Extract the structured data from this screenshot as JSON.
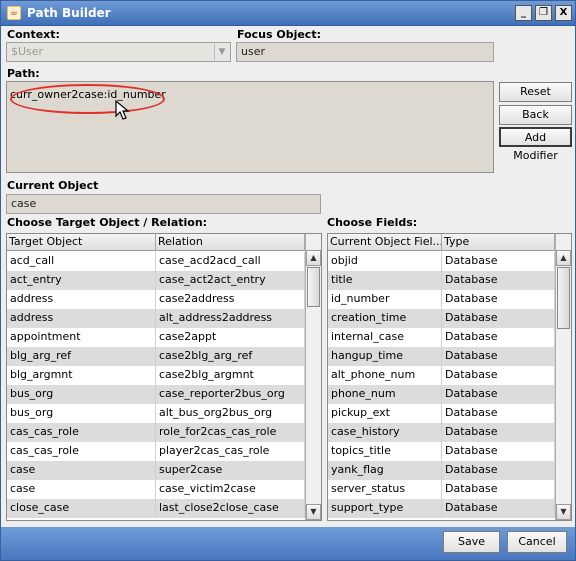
{
  "window": {
    "title": "Path Builder",
    "controls": [
      "_",
      "❐",
      "X"
    ]
  },
  "context": {
    "label": "Context:",
    "value": "$User"
  },
  "focus_object": {
    "label": "Focus Object:",
    "value": "user"
  },
  "path": {
    "label": "Path:",
    "value": "curr_owner2case:id_number"
  },
  "buttons": {
    "reset": "Reset",
    "back": "Back",
    "add_modifier": "Add Modifier",
    "save": "Save",
    "cancel": "Cancel"
  },
  "current_object": {
    "label": "Current Object",
    "value": "case"
  },
  "target_table": {
    "label": "Choose Target Object / Relation:",
    "columns": [
      "Target Object",
      "Relation"
    ],
    "rows": [
      [
        "acd_call",
        "case_acd2acd_call"
      ],
      [
        "act_entry",
        "case_act2act_entry"
      ],
      [
        "address",
        "case2address"
      ],
      [
        "address",
        "alt_address2address"
      ],
      [
        "appointment",
        "case2appt"
      ],
      [
        "blg_arg_ref",
        "case2blg_arg_ref"
      ],
      [
        "blg_argmnt",
        "case2blg_argmnt"
      ],
      [
        "bus_org",
        "case_reporter2bus_org"
      ],
      [
        "bus_org",
        "alt_bus_org2bus_org"
      ],
      [
        "cas_cas_role",
        "role_for2cas_cas_role"
      ],
      [
        "cas_cas_role",
        "player2cas_cas_role"
      ],
      [
        "case",
        "super2case"
      ],
      [
        "case",
        "case_victim2case"
      ],
      [
        "close_case",
        "last_close2close_case"
      ]
    ]
  },
  "fields_table": {
    "label": "Choose Fields:",
    "columns": [
      "Current Object Fiel...",
      "Type"
    ],
    "rows": [
      [
        "objid",
        "Database"
      ],
      [
        "title",
        "Database"
      ],
      [
        "id_number",
        "Database"
      ],
      [
        "creation_time",
        "Database"
      ],
      [
        "internal_case",
        "Database"
      ],
      [
        "hangup_time",
        "Database"
      ],
      [
        "alt_phone_num",
        "Database"
      ],
      [
        "phone_num",
        "Database"
      ],
      [
        "pickup_ext",
        "Database"
      ],
      [
        "case_history",
        "Database"
      ],
      [
        "topics_title",
        "Database"
      ],
      [
        "yank_flag",
        "Database"
      ],
      [
        "server_status",
        "Database"
      ],
      [
        "support_type",
        "Database"
      ]
    ]
  }
}
